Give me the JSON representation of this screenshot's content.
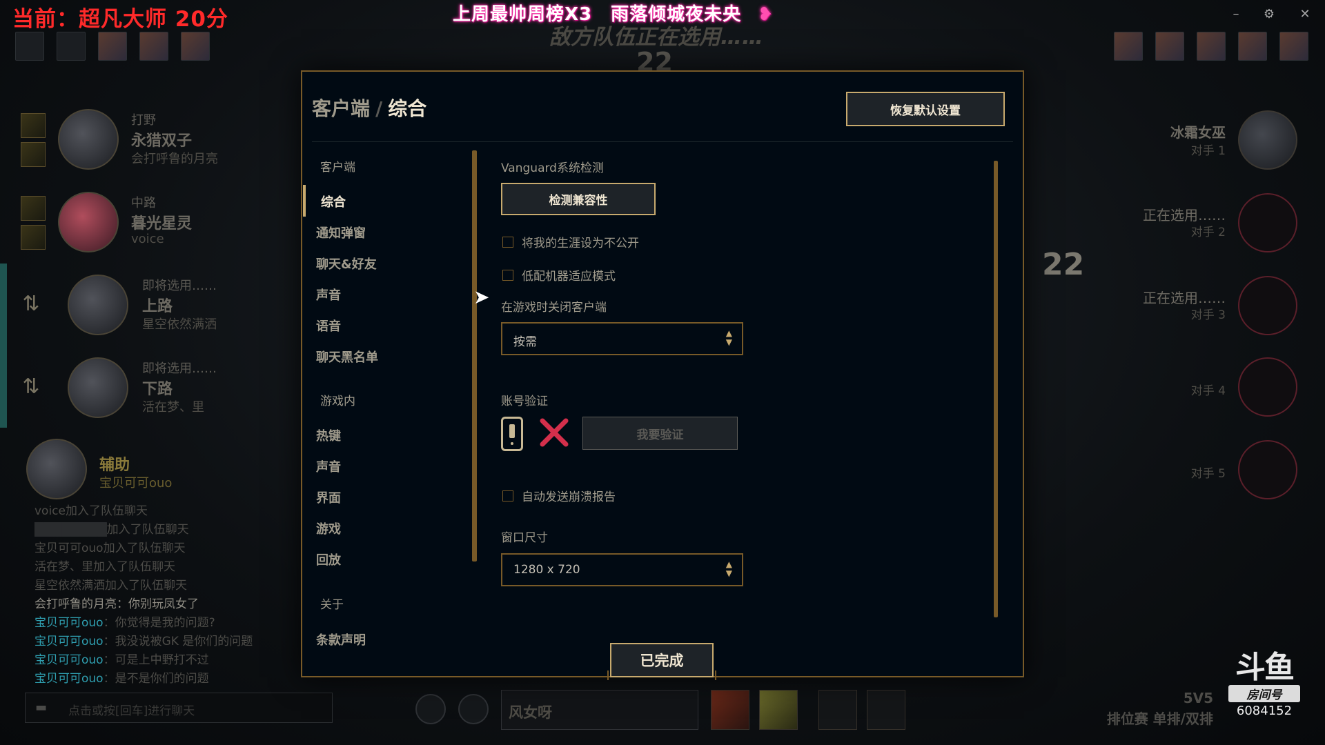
{
  "overlay": {
    "current": "当前：超凡大师 20分",
    "banner": "上周最帅周榜X3　雨落倾城夜未央",
    "enemy_picking": "敌方队伍正在选用……",
    "top_timer": "22",
    "right_timer": "22"
  },
  "window_controls": {
    "minimize": "–",
    "settings": "⚙",
    "close": "✕"
  },
  "left_team": [
    {
      "role": "打野",
      "champ": "永猎双子",
      "player": "会打呼鲁的月亮"
    },
    {
      "role": "中路",
      "champ": "暮光星灵",
      "player": "voice"
    },
    {
      "role": "即将选用……",
      "champ": "上路",
      "player": "星空依然满洒"
    },
    {
      "role": "即将选用……",
      "champ": "下路",
      "player": "活在梦、里"
    },
    {
      "role": "",
      "champ": "辅助",
      "player": "宝贝可可ouo"
    }
  ],
  "chat": [
    {
      "who": "",
      "text": "voice加入了队伍聊天"
    },
    {
      "who": "",
      "text": "加入了队伍聊天"
    },
    {
      "who": "",
      "text": "宝贝可可ouo加入了队伍聊天"
    },
    {
      "who": "",
      "text": "活在梦、里加入了队伍聊天"
    },
    {
      "who": "",
      "text": "星空依然满洒加入了队伍聊天"
    },
    {
      "who": "会打呼鲁的月亮",
      "text": "：你别玩凤女了"
    },
    {
      "who": "宝贝可可ouo",
      "text": "：你觉得是我的问题?"
    },
    {
      "who": "宝贝可可ouo",
      "text": "：我没说被GK 是你们的问题"
    },
    {
      "who": "宝贝可可ouo",
      "text": "：可是上中野打不过"
    },
    {
      "who": "宝贝可可ouo",
      "text": "：是不是你们的问题"
    }
  ],
  "chat_input_placeholder": "点击或按[回车]进行聊天",
  "right_team": [
    {
      "name": "冰霜女巫",
      "sub": "对手 1"
    },
    {
      "name": "正在选用……",
      "sub": "对手 2"
    },
    {
      "name": "正在选用……",
      "sub": "对手 3"
    },
    {
      "name": "",
      "sub": "对手 4"
    },
    {
      "name": "",
      "sub": "对手 5"
    }
  ],
  "mode": {
    "line1": "5V5",
    "line2": "排位赛 单排/双排"
  },
  "douyu": {
    "logo": "斗鱼",
    "room_label": "房间号",
    "room_number": "6084152"
  },
  "bottom": {
    "skin_select": "风女呀"
  },
  "settings": {
    "breadcrumb_parent": "客户端",
    "breadcrumb_sep": "/",
    "breadcrumb_current": "综合",
    "restore_label": "恢复默认设置",
    "nav": {
      "section_client": "客户端",
      "client_items": [
        "综合",
        "通知弹窗",
        "聊天&好友",
        "声音",
        "语音",
        "聊天黑名单"
      ],
      "section_ingame": "游戏内",
      "ingame_items": [
        "热键",
        "声音",
        "界面",
        "游戏",
        "回放"
      ],
      "section_about": "关于",
      "about_items": [
        "条款声明"
      ]
    },
    "vanguard_label": "Vanguard系统检测",
    "check_compat_label": "检测兼容性",
    "private_career_label": "将我的生涯设为不公开",
    "low_spec_label": "低配机器适应模式",
    "close_client_label": "在游戏时关闭客户端",
    "close_client_value": "按需",
    "account_verify_label": "账号验证",
    "verify_button_label": "我要验证",
    "auto_crash_label": "自动发送崩溃报告",
    "window_size_label": "窗口尺寸",
    "window_size_value": "1280 x 720",
    "done_label": "已完成"
  },
  "colors": {
    "gold": "#c8aa6e",
    "dark_gold": "#785a28",
    "bg": "#010a13",
    "cross": "#d42f4b"
  }
}
